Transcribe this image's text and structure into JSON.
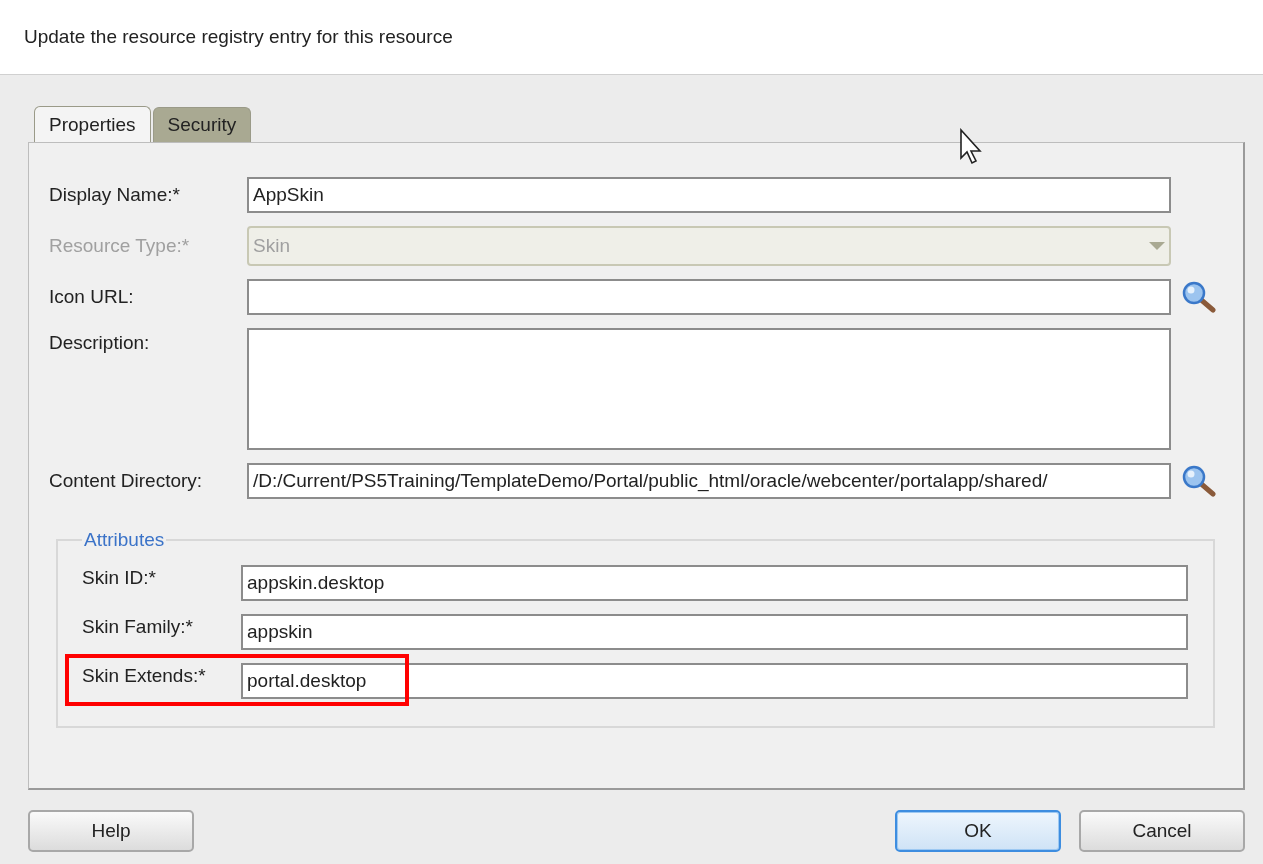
{
  "header": {
    "text": "Update the resource registry entry for this resource"
  },
  "tabs": [
    {
      "label": "Properties",
      "selected": true
    },
    {
      "label": "Security",
      "selected": false
    }
  ],
  "fields": [
    {
      "kind": "text",
      "label": "Display Name:*",
      "value": "AppSkin",
      "disabled": false
    },
    {
      "kind": "select",
      "label": "Resource Type:*",
      "value": "Skin",
      "disabled": true
    },
    {
      "kind": "browse",
      "label": "Icon URL:",
      "disabled": false
    },
    {
      "kind": "textarea",
      "label": "Description:",
      "disabled": false
    },
    {
      "kind": "browse",
      "label": "Content Directory:",
      "value": "/D:/Current/PS5Training/TemplateDemo/Portal/public_html/oracle/webcenter/portalapp/shared/",
      "disabled": false
    }
  ],
  "attributes": {
    "title": "Attributes",
    "fields": [
      {
        "label": "Skin ID:*",
        "value": "appskin.desktop",
        "highlighted": false
      },
      {
        "label": "Skin Family:*",
        "value": "appskin",
        "highlighted": false
      },
      {
        "label": "Skin Extends:*",
        "value": "portal.desktop",
        "highlighted": true
      }
    ]
  },
  "buttons": [
    {
      "label": "Help",
      "default": false
    },
    {
      "label": "OK",
      "default": true
    },
    {
      "label": "Cancel",
      "default": false
    }
  ]
}
